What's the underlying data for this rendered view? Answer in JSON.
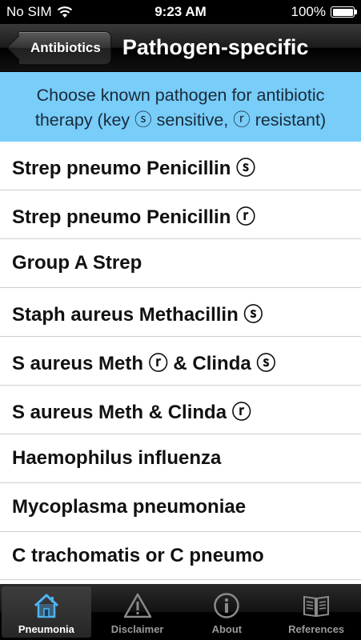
{
  "status_bar": {
    "carrier": "No SIM",
    "time": "9:23 AM",
    "battery": "100%",
    "battery_level": 1.0
  },
  "nav": {
    "back_label": "Antibiotics",
    "title": "Pathogen-specific"
  },
  "info": {
    "line1": "Choose known pathogen for antibiotic",
    "line2": "therapy (key ⓢ sensitive, ⓡ resistant)"
  },
  "pathogens": [
    "Strep pneumo Penicillin ⓢ",
    "Strep pneumo Penicillin ⓡ",
    "Group A Strep",
    "Staph aureus Methacillin ⓢ",
    "S aureus Meth ⓡ & Clinda ⓢ",
    "S aureus Meth & Clinda ⓡ",
    "Haemophilus influenza",
    "Mycoplasma pneumoniae",
    "C trachomatis or C pneumo"
  ],
  "tabs": [
    {
      "label": "Pneumonia",
      "icon": "home-icon",
      "active": true
    },
    {
      "label": "Disclaimer",
      "icon": "warning-icon",
      "active": false
    },
    {
      "label": "About",
      "icon": "info-icon",
      "active": false
    },
    {
      "label": "References",
      "icon": "book-icon",
      "active": false
    }
  ],
  "colors": {
    "info_background": "#78cdf9",
    "active_tab_icon": "#4fb3f0"
  }
}
